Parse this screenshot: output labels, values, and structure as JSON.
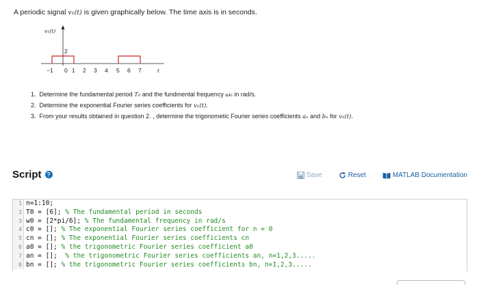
{
  "intro": {
    "prefix": "A periodic signal",
    "signal": "v₁(t)",
    "suffix": "is given graphically below. The time axis is in seconds."
  },
  "graph": {
    "y_label": "v₁(t)",
    "amplitude_label": "2",
    "x_axis_label": "t",
    "ticks": [
      "−1",
      "0",
      "1",
      "2",
      "3",
      "4",
      "5",
      "6",
      "7"
    ]
  },
  "questions": [
    {
      "num": "1.",
      "a": "Determine the fundamental period",
      "b": "T₀",
      "c": "and the fundmental frequency",
      "d": "ω₀",
      "e": "in rad/s."
    },
    {
      "num": "2.",
      "a": "Determine the exponential Fourier series coefficients for",
      "b": "v₁(t)",
      "c": "."
    },
    {
      "num": "3.",
      "a": "From your results obtained in question 2. , determine the trigonometic Fourier series coefficients",
      "b": "aₙ",
      "c": "and",
      "d": "bₙ",
      "e": "for",
      "f": "v₁(t)",
      "g": "."
    }
  ],
  "script": {
    "title": "Script",
    "save_label": "Save",
    "reset_label": "Reset",
    "doc_label": "MATLAB Documentation"
  },
  "code_lines": [
    {
      "num": "1",
      "code": "n=1:10;",
      "comment": ""
    },
    {
      "num": "2",
      "code": "T0 = [6]; ",
      "comment": "% The fundamental period in seconds"
    },
    {
      "num": "3",
      "code": "w0 = [2*pi/6]; ",
      "comment": "% The fundamental frequency in rad/s"
    },
    {
      "num": "4",
      "code": "c0 = []; ",
      "comment": "% The exponential Fourier series coefficient for n = 0"
    },
    {
      "num": "5",
      "code": "cn = []; ",
      "comment": "% The exponential Fourier series coefficients cn"
    },
    {
      "num": "6",
      "code": "a0 = []; ",
      "comment": "% the trigonometric Fourier series coefficient a0"
    },
    {
      "num": "7",
      "code": "an = [];  ",
      "comment": "% the trigonometric Fourier series coefficients an, n=1,2,3....."
    },
    {
      "num": "8",
      "code": "bn = []; ",
      "comment": "% the trigonometric Fourier series coefficients bn, n=1,2,3....."
    }
  ],
  "colors": {
    "accent": "#1a5fa0",
    "signal": "#c62828",
    "comment": "#228b22"
  }
}
